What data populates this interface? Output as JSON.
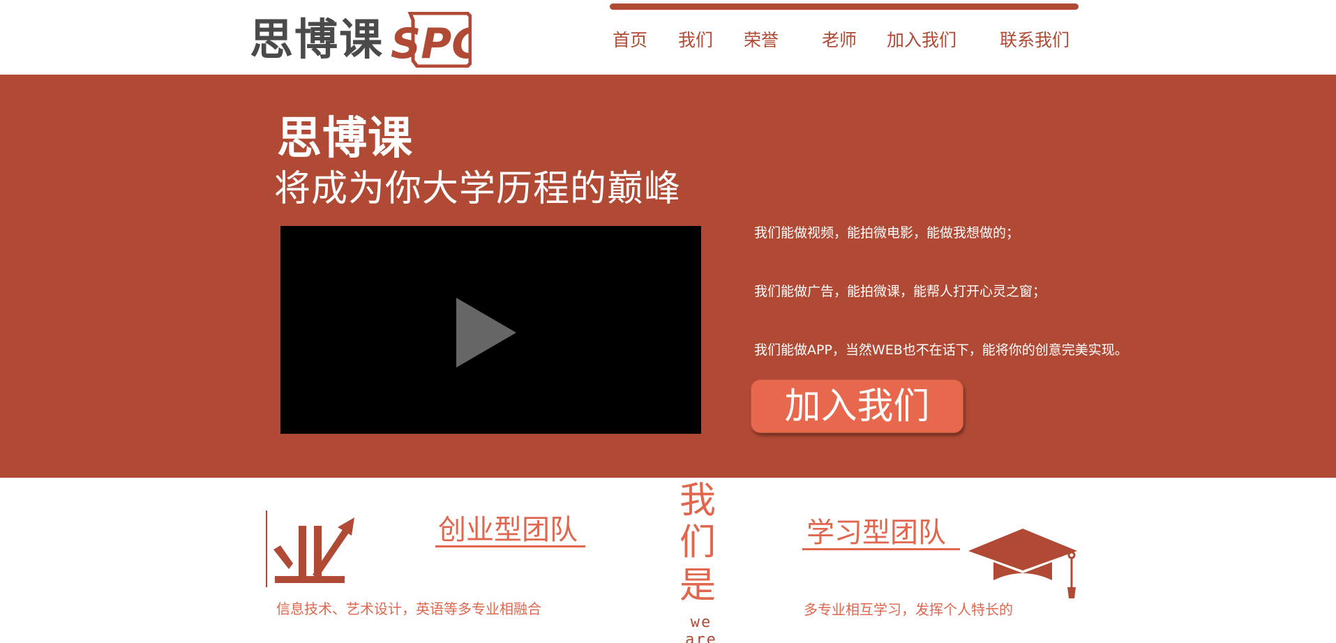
{
  "header": {
    "logo_text": "思博课",
    "logo_badge_text": "SPC",
    "nav": [
      {
        "label": "首页"
      },
      {
        "label": "我们"
      },
      {
        "label": "荣誉"
      },
      {
        "label": "老师"
      },
      {
        "label": "加入我们"
      },
      {
        "label": "联系我们"
      }
    ]
  },
  "hero": {
    "brand": "思博课",
    "tagline": "将成为你大学历程的巅峰",
    "lines": [
      "我们能做视频，能拍微电影，能做我想做的；",
      "我们能做广告，能拍微课，能帮人打开心灵之窗；",
      "我们能做APP，当然WEB也不在话下，能将你的创意完美实现。"
    ],
    "join_label": "加入我们"
  },
  "features": {
    "left_title": "创业型团队",
    "left_desc": "信息技术、艺术设计，英语等多专业相融合",
    "center_chars": [
      "我",
      "们",
      "是"
    ],
    "center_sub": "we are",
    "right_title": "学习型团队",
    "right_desc": "多专业相互学习，发挥个人特长的"
  },
  "icons": {
    "play": "play-icon",
    "growth": "growth-chart-icon",
    "graduation": "graduation-cap-icon"
  },
  "colors": {
    "brand": "#b04a35",
    "accent": "#e8684e",
    "feature_text": "#e0664e",
    "logo_gray": "#4a4a4a"
  }
}
